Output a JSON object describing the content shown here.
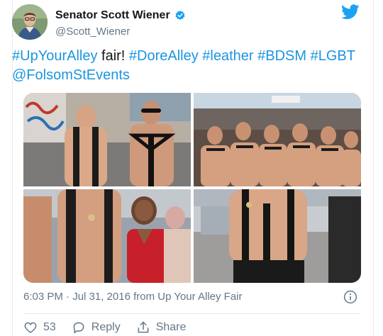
{
  "tweet": {
    "display_name": "Senator Scott Wiener",
    "handle": "@Scott_Wiener",
    "text_parts": [
      {
        "text": "#UpYourAlley",
        "link": true
      },
      {
        "text": " fair! ",
        "link": false
      },
      {
        "text": "#DoreAlley",
        "link": true
      },
      {
        "text": " ",
        "link": false
      },
      {
        "text": "#leather",
        "link": true
      },
      {
        "text": " ",
        "link": false
      },
      {
        "text": "#BDSM",
        "link": true
      },
      {
        "text": " ",
        "link": false
      },
      {
        "text": "#LGBT",
        "link": true
      },
      {
        "text": " ",
        "link": false
      },
      {
        "text": "@FolsomStEvents",
        "link": true
      }
    ],
    "timestamp_line": "6:03 PM · Jul 31, 2016 from Up Your Alley Fair",
    "like_count": "53",
    "reply_label": "Reply",
    "share_label": "Share"
  },
  "icons": {
    "verified": "verified-badge-icon",
    "bird": "twitter-bird-icon",
    "info": "info-icon",
    "like": "heart-icon",
    "reply": "reply-icon",
    "share": "share-icon"
  },
  "colors": {
    "link": "#1b95e0",
    "twitter_blue": "#1da1f2",
    "muted": "#657786",
    "border": "#e6ecf0"
  },
  "media": {
    "photo_count": 4
  }
}
